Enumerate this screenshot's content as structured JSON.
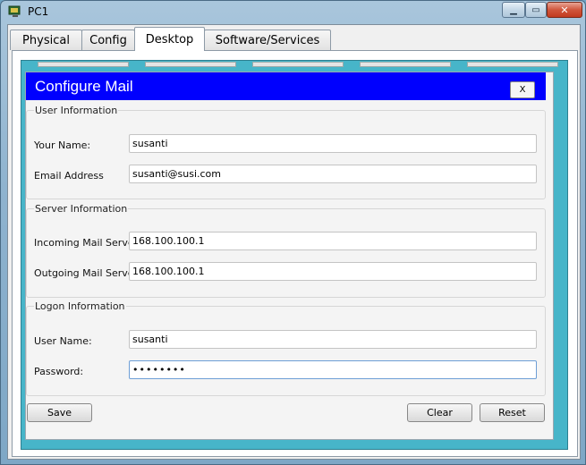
{
  "window": {
    "title": "PC1"
  },
  "tabs": [
    {
      "label": "Physical"
    },
    {
      "label": "Config"
    },
    {
      "label": "Desktop",
      "active": true
    },
    {
      "label": "Software/Services"
    }
  ],
  "dialog": {
    "title": "Configure Mail",
    "close_label": "X",
    "user_info": {
      "legend": "User Information",
      "name_label": "Your Name:",
      "name_value": "susanti",
      "email_label": "Email Address",
      "email_value": "susanti@susi.com"
    },
    "server_info": {
      "legend": "Server Information",
      "incoming_label": "Incoming Mail Server",
      "incoming_value": "168.100.100.1",
      "outgoing_label": "Outgoing Mail Server",
      "outgoing_value": "168.100.100.1"
    },
    "logon_info": {
      "legend": "Logon Information",
      "username_label": "User Name:",
      "username_value": "susanti",
      "password_label": "Password:",
      "password_value": "••••••••"
    },
    "buttons": {
      "save": "Save",
      "clear": "Clear",
      "reset": "Reset"
    }
  },
  "colors": {
    "dialog_header": "#0000fe",
    "desktop_background": "#47b5c9"
  }
}
